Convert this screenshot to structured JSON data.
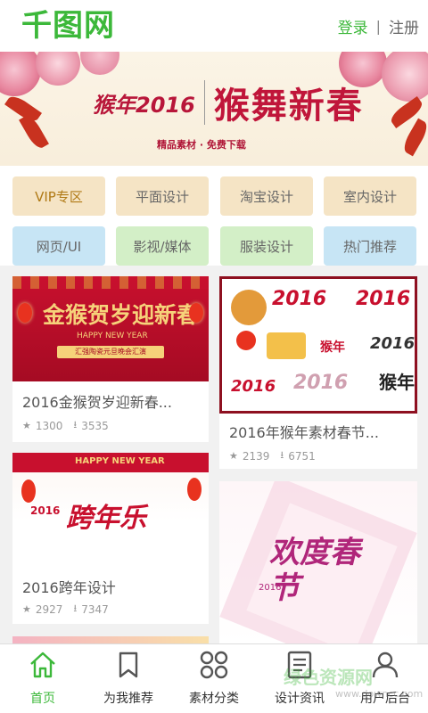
{
  "header": {
    "logo": "千图网",
    "login": "登录",
    "separator": "|",
    "register": "注册"
  },
  "banner": {
    "small_text": "猴年2016",
    "big_text": "猴舞新春",
    "sub_text": "精品素材 · 免费下载",
    "slides": 3,
    "active_slide": 2
  },
  "categories": [
    {
      "label": "VIP专区",
      "bg": "#f5e4c5",
      "color": "#b07a16"
    },
    {
      "label": "平面设计",
      "bg": "#f5e4c5",
      "color": "#666666"
    },
    {
      "label": "淘宝设计",
      "bg": "#f5e4c5",
      "color": "#666666"
    },
    {
      "label": "室内设计",
      "bg": "#f5e4c5",
      "color": "#666666"
    },
    {
      "label": "网页/UI",
      "bg": "#c7e5f5",
      "color": "#666666"
    },
    {
      "label": "影视/媒体",
      "bg": "#d3efc7",
      "color": "#666666"
    },
    {
      "label": "服装设计",
      "bg": "#d3efc7",
      "color": "#666666"
    },
    {
      "label": "热门推荐",
      "bg": "#c7e5f5",
      "color": "#666666"
    }
  ],
  "cards": [
    {
      "title": "2016金猴贺岁迎新春...",
      "views": "1300",
      "downloads": "3535",
      "image_text": "金猴贺岁迎新春",
      "image_sub": "HAPPY NEW YEAR",
      "image_sub2": "汇强陶瓷元旦晚会汇演"
    },
    {
      "title": "2016年猴年素材春节...",
      "views": "2139",
      "downloads": "6751",
      "image_text": "2016",
      "image_sub": "猴年"
    },
    {
      "title": "2016跨年设计",
      "views": "2927",
      "downloads": "7347",
      "image_text": "跨年乐",
      "image_sub": "HAPPY NEW YEAR",
      "image_sub2": "2016"
    },
    {
      "title": "",
      "views": "",
      "downloads": "",
      "image_text": "欢度春节",
      "image_sub": "2016"
    }
  ],
  "tabs": [
    {
      "label": "首页",
      "icon": "home-icon"
    },
    {
      "label": "为我推荐",
      "icon": "bookmark-icon"
    },
    {
      "label": "素材分类",
      "icon": "grid-icon"
    },
    {
      "label": "设计资讯",
      "icon": "news-icon"
    },
    {
      "label": "用户后台",
      "icon": "user-icon"
    }
  ],
  "watermark": "绿色资源网",
  "watermark_url": "www.downcc.com",
  "colors": {
    "brand": "#3cb83a",
    "festive_red": "#c8102e"
  }
}
